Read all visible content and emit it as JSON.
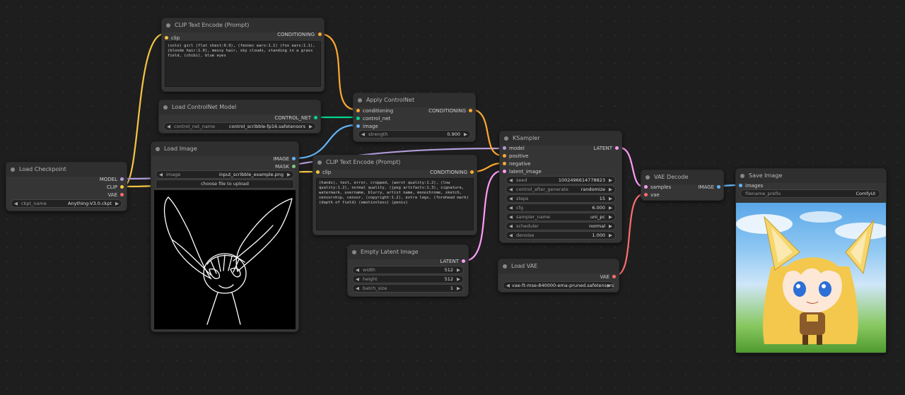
{
  "colors": {
    "canvas": "#1e1e1e",
    "node_body": "#353535",
    "node_title": "#2f2f2f",
    "clip": "#f5c542",
    "conditioning": "#ffa931",
    "model": "#b39ddb",
    "vae": "#ff6e6e",
    "latent": "#ff9cf9",
    "image": "#64b5f6",
    "control_net": "#00d78d",
    "mask": "#81c784"
  },
  "nodes": {
    "clip_pos": {
      "title": "CLIP Text Encode (Prompt)",
      "in_clip": "clip",
      "out": "CONDITIONING",
      "text": "(solo) girl (flat chest:0.9), (fennec ears:1.1)  (fox ears:1.1), (blonde hair:1.0), messy hair, sky clouds, standing in a grass field, (chibi), blue eyes"
    },
    "cn_loader": {
      "title": "Load ControlNet Model",
      "out": "CONTROL_NET",
      "w_label": "control_net_name",
      "w_value": "control_scribble-fp16.safetensors"
    },
    "apply_cn": {
      "title": "Apply ControlNet",
      "in_cond": "conditioning",
      "in_cn": "control_net",
      "in_image": "image",
      "out": "CONDITIONING",
      "w_label": "strength",
      "w_value": "0.900"
    },
    "load_image": {
      "title": "Load Image",
      "out_image": "IMAGE",
      "out_mask": "MASK",
      "w_label": "image",
      "w_value": "input_scribble_example.png",
      "upload": "choose file to upload"
    },
    "checkpoint": {
      "title": "Load Checkpoint",
      "out_model": "MODEL",
      "out_clip": "CLIP",
      "out_vae": "VAE",
      "w_label": "ckpt_name",
      "w_value": "Anything-V3.0.ckpt"
    },
    "clip_neg": {
      "title": "CLIP Text Encode (Prompt)",
      "in_clip": "clip",
      "out": "CONDITIONING",
      "text": "(hands), text, error, cropped, (worst quality:1.2), (low quality:1.2), normal quality, (jpeg artifacts:1.3), signature, watermark, username, blurry, artist name, monochrome, sketch, censorship, censor, (copyright:1.2), extra legs, (forehead mark) (depth of field) (emotionless) (penis)"
    },
    "ksampler": {
      "title": "KSampler",
      "in_model": "model",
      "in_pos": "positive",
      "in_neg": "negative",
      "in_latent": "latent_image",
      "out": "LATENT",
      "widgets": [
        {
          "label": "seed",
          "value": "1002496614778823"
        },
        {
          "label": "control_after_generate",
          "value": "randomize"
        },
        {
          "label": "steps",
          "value": "15"
        },
        {
          "label": "cfg",
          "value": "6.000"
        },
        {
          "label": "sampler_name",
          "value": "uni_pc"
        },
        {
          "label": "scheduler",
          "value": "normal"
        },
        {
          "label": "denoise",
          "value": "1.000"
        }
      ]
    },
    "empty_latent": {
      "title": "Empty Latent Image",
      "out": "LATENT",
      "widgets": [
        {
          "label": "width",
          "value": "512"
        },
        {
          "label": "height",
          "value": "512"
        },
        {
          "label": "batch_size",
          "value": "1"
        }
      ]
    },
    "load_vae": {
      "title": "Load VAE",
      "out": "VAE",
      "w_value": "vae-ft-mse-840000-ema-pruned.safetensors"
    },
    "vae_decode": {
      "title": "VAE Decode",
      "in_samples": "samples",
      "in_vae": "vae",
      "out": "IMAGE"
    },
    "save_image": {
      "title": "Save Image",
      "in_images": "images",
      "w_label": "filename_prefix",
      "w_value": "ComfyUI"
    }
  }
}
